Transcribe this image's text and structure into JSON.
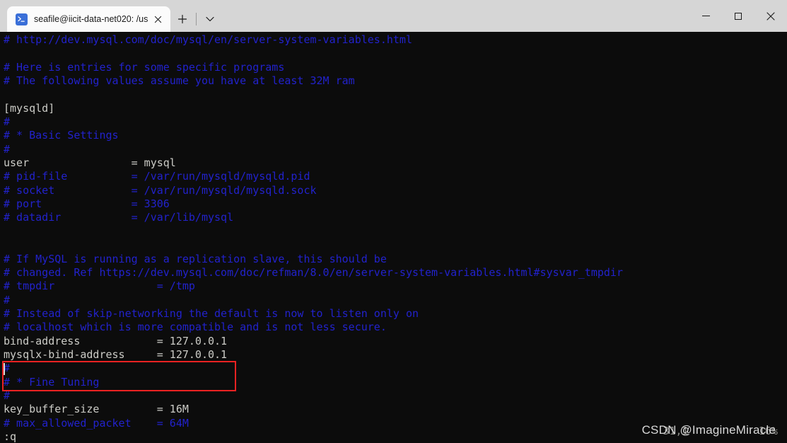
{
  "window": {
    "tab": {
      "title": "seafile@iicit-data-net020: /us",
      "icon": "terminal-prompt-icon",
      "close_label": "✕"
    },
    "new_tab_label": "+",
    "tab_menu_label": "⌄",
    "controls": {
      "minimize_label": "─",
      "maximize_label": "□",
      "close_label": "✕"
    }
  },
  "terminal": {
    "background": "#0c0c0c",
    "comment_color": "#2222cc",
    "text_color": "#ccccc7",
    "lines": [
      {
        "text": "# http://dev.mysql.com/doc/mysql/en/server-system-variables.html",
        "style": "comment"
      },
      {
        "text": "",
        "style": "normal"
      },
      {
        "text": "# Here is entries for some specific programs",
        "style": "comment"
      },
      {
        "text": "# The following values assume you have at least 32M ram",
        "style": "comment"
      },
      {
        "text": "",
        "style": "normal"
      },
      {
        "text": "[mysqld]",
        "style": "normal"
      },
      {
        "text": "#",
        "style": "comment"
      },
      {
        "text": "# * Basic Settings",
        "style": "comment"
      },
      {
        "text": "#",
        "style": "comment"
      },
      {
        "text": "user                = mysql",
        "style": "normal"
      },
      {
        "text": "# pid-file          = /var/run/mysqld/mysqld.pid",
        "style": "comment"
      },
      {
        "text": "# socket            = /var/run/mysqld/mysqld.sock",
        "style": "comment"
      },
      {
        "text": "# port              = 3306",
        "style": "comment"
      },
      {
        "text": "# datadir           = /var/lib/mysql",
        "style": "comment"
      },
      {
        "text": "",
        "style": "normal"
      },
      {
        "text": "",
        "style": "normal"
      },
      {
        "text": "# If MySQL is running as a replication slave, this should be",
        "style": "comment"
      },
      {
        "text": "# changed. Ref https://dev.mysql.com/doc/refman/8.0/en/server-system-variables.html#sysvar_tmpdir",
        "style": "comment"
      },
      {
        "text": "# tmpdir                = /tmp",
        "style": "comment"
      },
      {
        "text": "#",
        "style": "comment"
      },
      {
        "text": "# Instead of skip-networking the default is now to listen only on",
        "style": "comment"
      },
      {
        "text": "# localhost which is more compatible and is not less secure.",
        "style": "comment"
      },
      {
        "text": "bind-address            = 127.0.0.1",
        "style": "normal"
      },
      {
        "text": "mysqlx-bind-address     = 127.0.0.1",
        "style": "normal"
      },
      {
        "text": "#",
        "style": "comment"
      },
      {
        "text": "# * Fine Tuning",
        "style": "comment"
      },
      {
        "text": "#",
        "style": "comment"
      },
      {
        "text": "key_buffer_size         = 16M",
        "style": "normal"
      },
      {
        "text": "# max_allowed_packet    = 64M",
        "style": "comment"
      },
      {
        "text": ":q",
        "style": "normal"
      }
    ],
    "ruler": "31,1           16%",
    "annotation": {
      "type": "red-rectangle",
      "color": "#ee2222",
      "covers": [
        "bind-address            = 127.0.0.1",
        "mysqlx-bind-address     = 127.0.0.1"
      ]
    }
  },
  "watermark": {
    "text": "CSDN @ImagineMiracle"
  }
}
